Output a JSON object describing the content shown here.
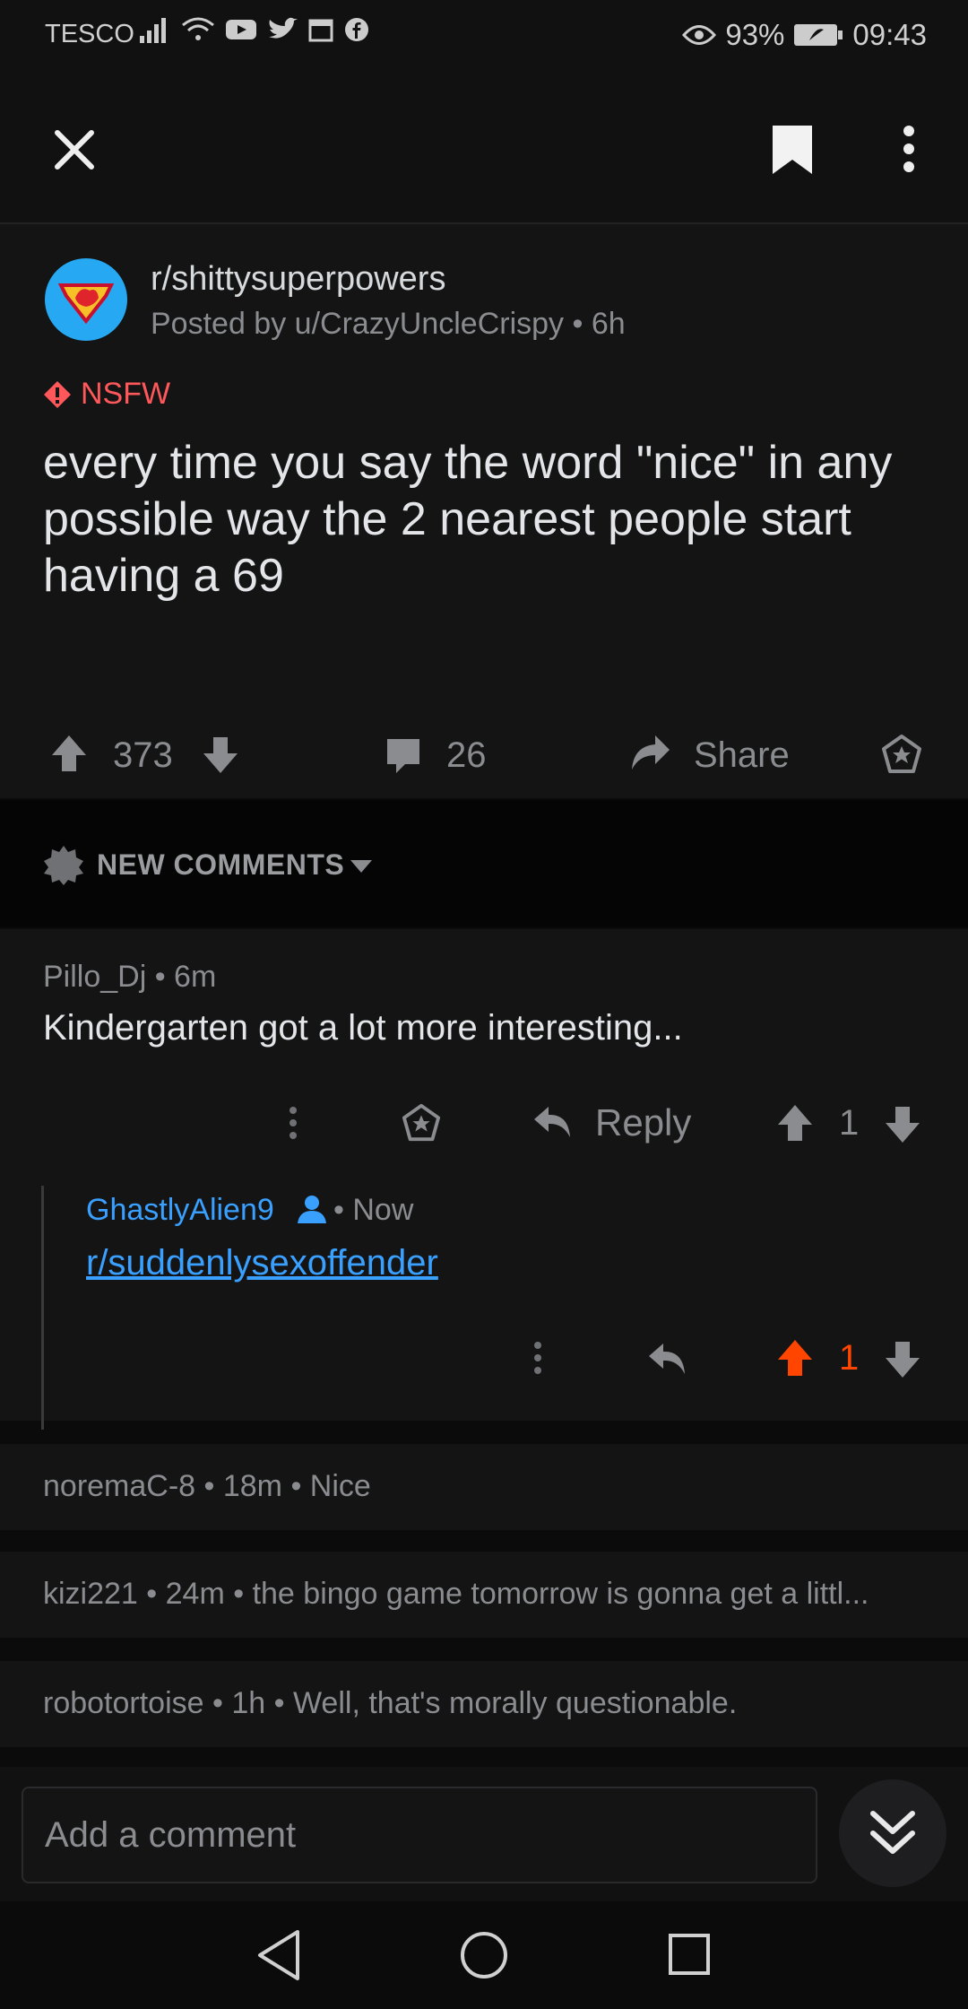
{
  "status_bar": {
    "carrier": "TESCO",
    "battery": "93%",
    "time": "09:43"
  },
  "post": {
    "subreddit": "r/shittysuperpowers",
    "meta": "Posted by u/CrazyUncleCrispy • 6h",
    "nsfw_label": "NSFW",
    "title": "every time you say the word \"nice\" in any possible way the 2 nearest people start having a 69",
    "score": "373",
    "comments": "26",
    "share_label": "Share"
  },
  "sort": {
    "label": "NEW COMMENTS"
  },
  "comments": [
    {
      "author_meta": "Pillo_Dj • 6m",
      "body": "Kindergarten got a lot more interesting...",
      "reply_label": "Reply",
      "score": "1"
    },
    {
      "author": "GhastlyAlien9",
      "time": "• Now",
      "body_link": "r/suddenlysexoffender",
      "score": "1"
    }
  ],
  "collapsed_comments": [
    {
      "text": "noremaC-8 • 18m • Nice"
    },
    {
      "text": "kizi221 • 24m • the bingo game tomorrow is gonna get a littl..."
    },
    {
      "text": "robotortoise • 1h • Well, that's morally questionable."
    }
  ],
  "comment_bar": {
    "placeholder": "Add a comment"
  },
  "colors": {
    "upvote": "#ff4500",
    "link": "#3aa0ff",
    "nsfw": "#ff585b",
    "background": "#0b0b0b"
  }
}
